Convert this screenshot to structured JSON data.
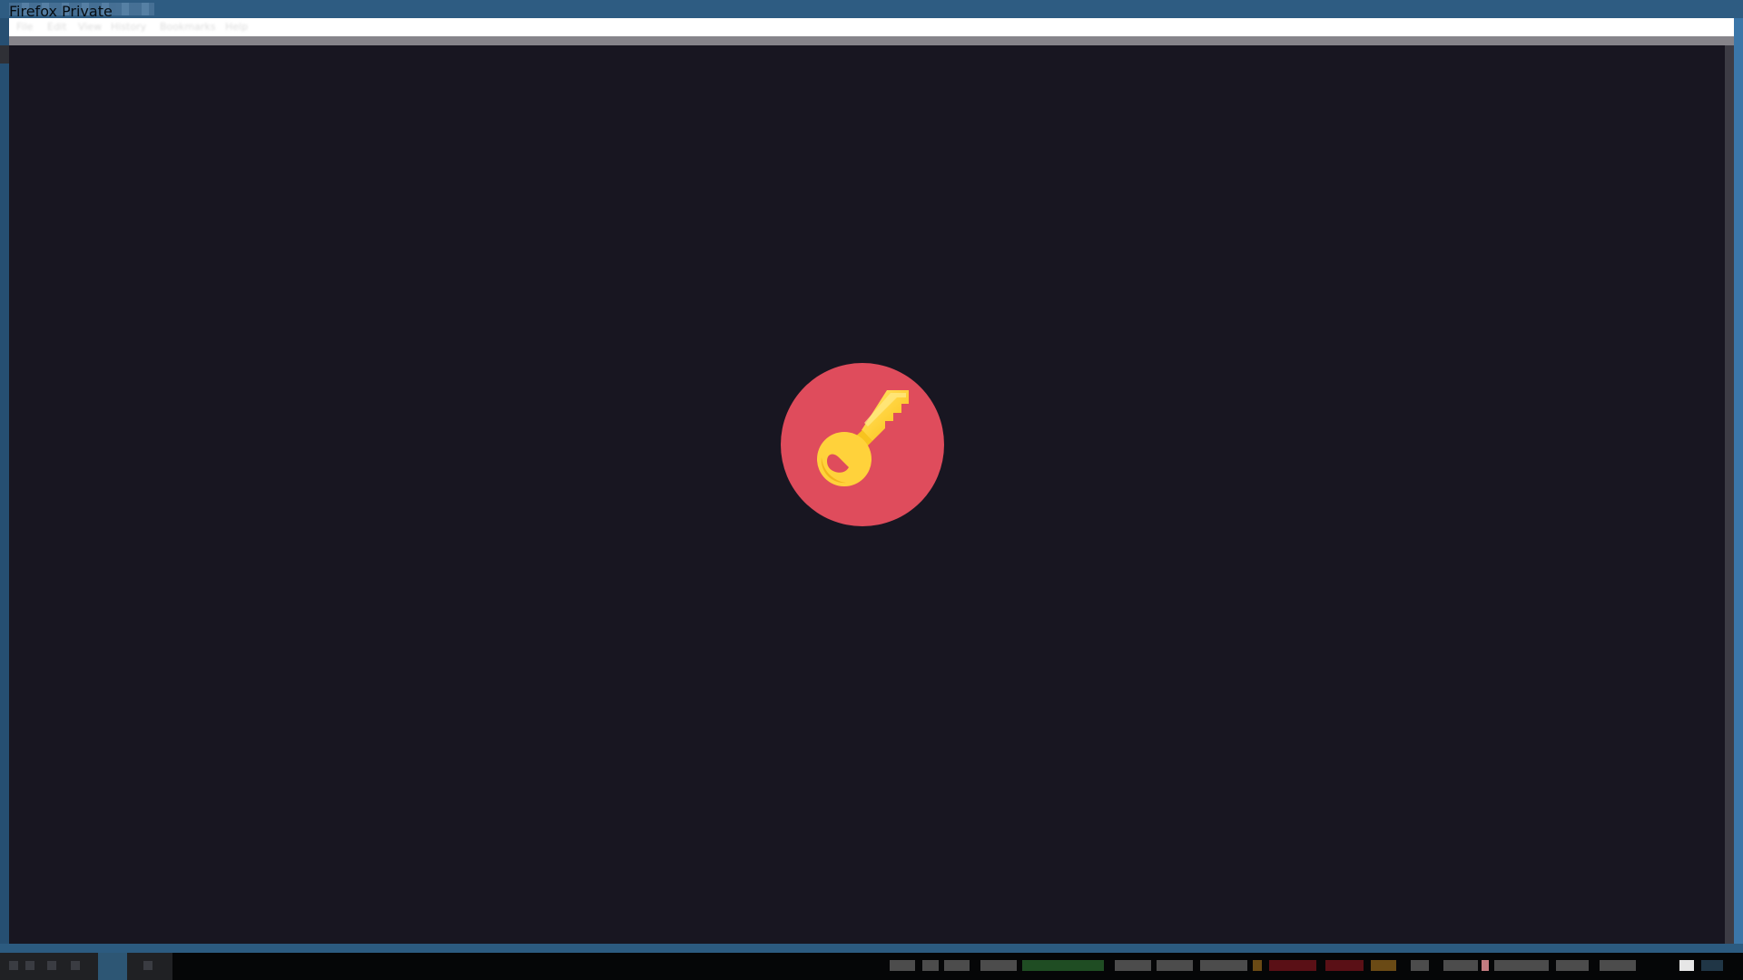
{
  "window": {
    "title": "Firefox Private Browsing"
  },
  "menu": {
    "items": [
      "File",
      "Edit",
      "View",
      "History",
      "Bookmarks",
      "Help"
    ]
  },
  "badge": {
    "icon": "key-icon",
    "background": "#df4c5c",
    "key_color": "#ffd13c"
  },
  "taskbar": {
    "items": [
      "workspace-1",
      "workspace-2",
      "workspace-3"
    ],
    "tray_status": "status indicators"
  }
}
